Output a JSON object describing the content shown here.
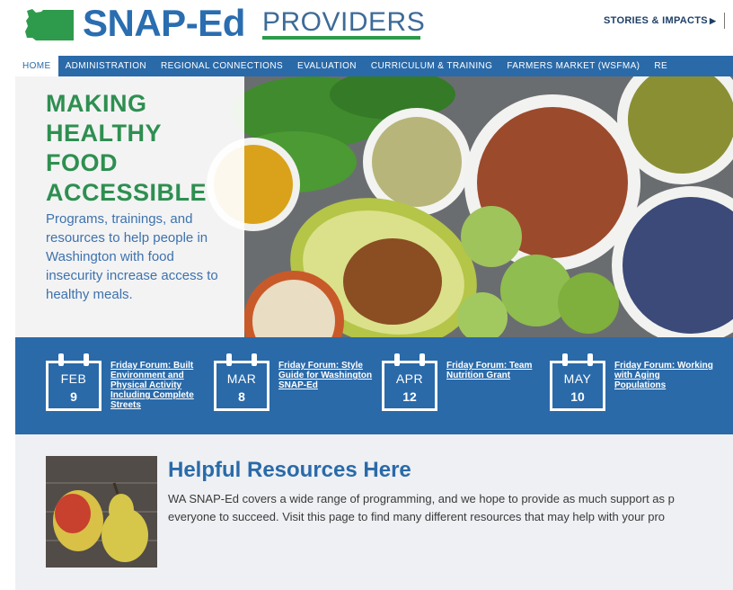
{
  "header": {
    "logo_primary": "SNAP-Ed",
    "logo_secondary": "PROVIDERS",
    "top_link": "STORIES & IMPACTS",
    "brand_color": "#2a6db0",
    "accent_green": "#2e9b4c"
  },
  "nav": {
    "items": [
      {
        "label": "HOME",
        "active": true
      },
      {
        "label": "ADMINISTRATION"
      },
      {
        "label": "REGIONAL CONNECTIONS"
      },
      {
        "label": "EVALUATION"
      },
      {
        "label": "CURRICULUM & TRAINING"
      },
      {
        "label": "FARMERS MARKET (WSFMA)"
      },
      {
        "label": "RE"
      }
    ]
  },
  "hero": {
    "title_lines": [
      "MAKING",
      "HEALTHY",
      "FOOD",
      "ACCESSIBLE"
    ],
    "body": "Programs, trainings, and resources to help people in Washington with food insecurity increase access to healthy meals."
  },
  "events": [
    {
      "month": "FEB",
      "day": "9",
      "title": "Friday Forum: Built Environment and Physical Activity Including Complete Streets"
    },
    {
      "month": "MAR",
      "day": "8",
      "title": "Friday Forum: Style Guide for Washington SNAP-Ed"
    },
    {
      "month": "APR",
      "day": "12",
      "title": "Friday Forum: Team Nutrition Grant"
    },
    {
      "month": "MAY",
      "day": "10",
      "title": "Friday Forum: Working with Aging Populations"
    }
  ],
  "resources": {
    "title": "Helpful Resources Here",
    "text_line1": "WA SNAP-Ed covers a wide range of programming, and we hope to provide as much support as p",
    "text_line2": "everyone to succeed. Visit this page to find many different resources that may help with your pro"
  }
}
